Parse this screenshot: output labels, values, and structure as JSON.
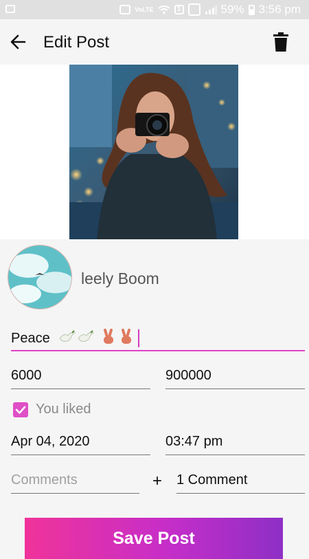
{
  "status_bar": {
    "battery": "59%",
    "time": "3:56 pm",
    "network_label": "VoLTE",
    "notification_badge": "1"
  },
  "app_bar": {
    "title": "Edit Post"
  },
  "post": {
    "username": "leely Boom",
    "caption_text": "Peace ",
    "caption_emojis": [
      "dove-emoji",
      "dove-emoji",
      "victory-hand-emoji",
      "victory-hand-emoji"
    ],
    "likes": "6000",
    "views": "900000",
    "liked_label": "You liked",
    "liked": true,
    "date": "Apr 04, 2020",
    "time": "03:47 pm",
    "comments_placeholder": "Comments",
    "add_symbol": "+",
    "comment_count": "1 Comment"
  },
  "actions": {
    "save_label": "Save Post"
  },
  "colors": {
    "accent": "#e040c8",
    "button_gradient_start": "#f0339a",
    "button_gradient_end": "#8e2fc6"
  }
}
